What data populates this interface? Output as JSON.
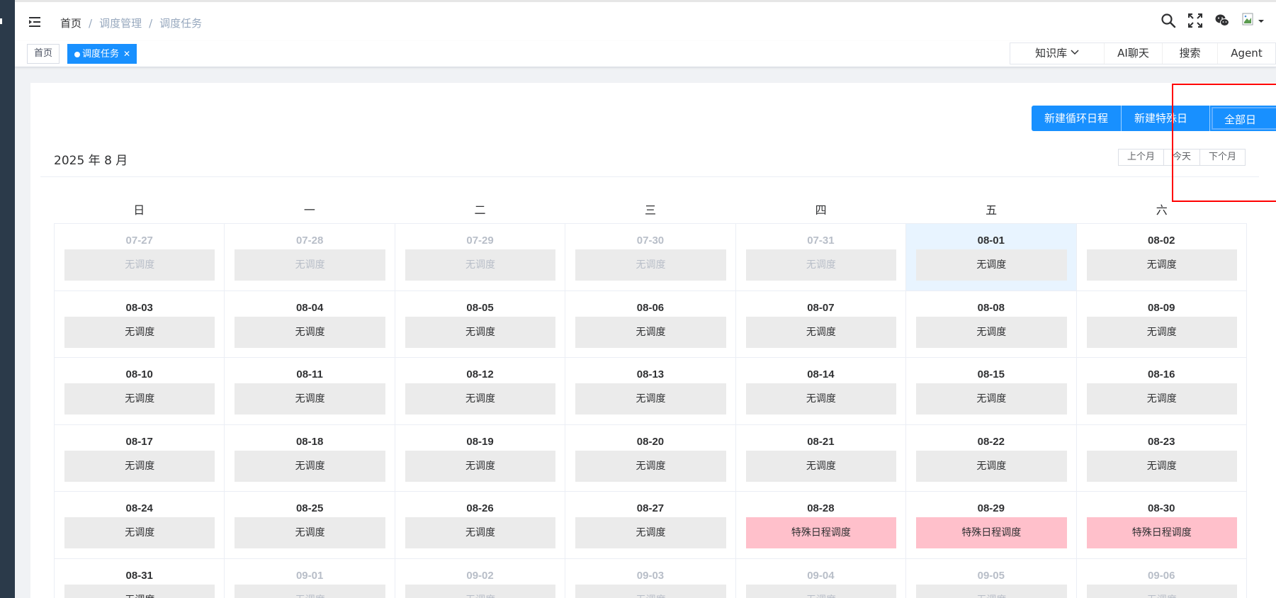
{
  "breadcrumb": [
    "首页",
    "调度管理",
    "调度任务"
  ],
  "tags": {
    "home": "首页",
    "active": "调度任务"
  },
  "topnav": {
    "knowledge_base": "知识库",
    "ai_chat": "AI聊天",
    "search": "搜索",
    "agent": "Agent"
  },
  "actions": {
    "new_recurring": "新建循环日程",
    "new_special": "新建特殊日程",
    "all": "全部日程"
  },
  "calendar": {
    "month_title": "2025 年 8 月",
    "prev": "上个月",
    "today": "今天",
    "next": "下个月",
    "weekdays": [
      "日",
      "一",
      "二",
      "三",
      "四",
      "五",
      "六"
    ],
    "weeks": [
      [
        {
          "date": "07-27",
          "label": "无调度",
          "other": true
        },
        {
          "date": "07-28",
          "label": "无调度",
          "other": true
        },
        {
          "date": "07-29",
          "label": "无调度",
          "other": true
        },
        {
          "date": "07-30",
          "label": "无调度",
          "other": true
        },
        {
          "date": "07-31",
          "label": "无调度",
          "other": true
        },
        {
          "date": "08-01",
          "label": "无调度",
          "today": true
        },
        {
          "date": "08-02",
          "label": "无调度"
        }
      ],
      [
        {
          "date": "08-03",
          "label": "无调度"
        },
        {
          "date": "08-04",
          "label": "无调度"
        },
        {
          "date": "08-05",
          "label": "无调度"
        },
        {
          "date": "08-06",
          "label": "无调度"
        },
        {
          "date": "08-07",
          "label": "无调度"
        },
        {
          "date": "08-08",
          "label": "无调度"
        },
        {
          "date": "08-09",
          "label": "无调度"
        }
      ],
      [
        {
          "date": "08-10",
          "label": "无调度"
        },
        {
          "date": "08-11",
          "label": "无调度"
        },
        {
          "date": "08-12",
          "label": "无调度"
        },
        {
          "date": "08-13",
          "label": "无调度"
        },
        {
          "date": "08-14",
          "label": "无调度"
        },
        {
          "date": "08-15",
          "label": "无调度"
        },
        {
          "date": "08-16",
          "label": "无调度"
        }
      ],
      [
        {
          "date": "08-17",
          "label": "无调度"
        },
        {
          "date": "08-18",
          "label": "无调度"
        },
        {
          "date": "08-19",
          "label": "无调度"
        },
        {
          "date": "08-20",
          "label": "无调度"
        },
        {
          "date": "08-21",
          "label": "无调度"
        },
        {
          "date": "08-22",
          "label": "无调度"
        },
        {
          "date": "08-23",
          "label": "无调度"
        }
      ],
      [
        {
          "date": "08-24",
          "label": "无调度"
        },
        {
          "date": "08-25",
          "label": "无调度"
        },
        {
          "date": "08-26",
          "label": "无调度"
        },
        {
          "date": "08-27",
          "label": "无调度"
        },
        {
          "date": "08-28",
          "label": "特殊日程调度",
          "special": true
        },
        {
          "date": "08-29",
          "label": "特殊日程调度",
          "special": true
        },
        {
          "date": "08-30",
          "label": "特殊日程调度",
          "special": true
        }
      ],
      [
        {
          "date": "08-31",
          "label": "无调度"
        },
        {
          "date": "09-01",
          "label": "无调度",
          "other": true
        },
        {
          "date": "09-02",
          "label": "无调度",
          "other": true
        },
        {
          "date": "09-03",
          "label": "无调度",
          "other": true
        },
        {
          "date": "09-04",
          "label": "无调度",
          "other": true
        },
        {
          "date": "09-05",
          "label": "无调度",
          "other": true
        },
        {
          "date": "09-06",
          "label": "无调度",
          "other": true
        }
      ]
    ]
  },
  "colors": {
    "primary": "#1890ff",
    "special": "#ffc0cb",
    "today_bg": "#e8f4ff",
    "highlight": "#ff0000"
  }
}
